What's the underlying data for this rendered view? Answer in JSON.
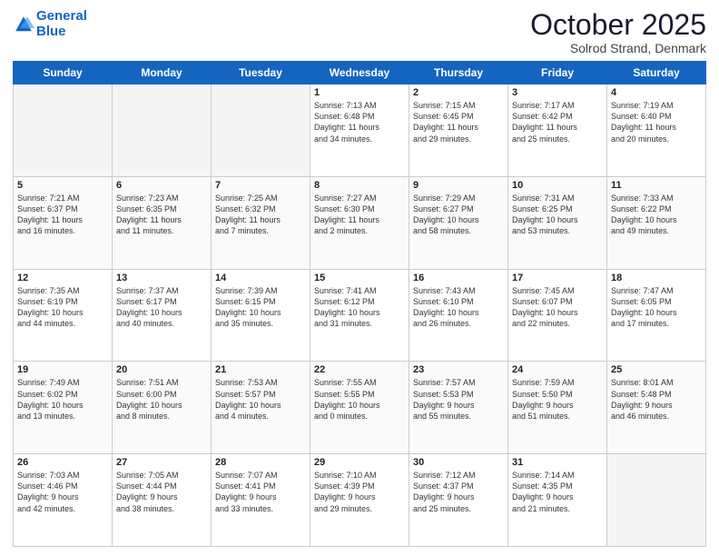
{
  "header": {
    "logo_line1": "General",
    "logo_line2": "Blue",
    "month": "October 2025",
    "location": "Solrod Strand, Denmark"
  },
  "weekdays": [
    "Sunday",
    "Monday",
    "Tuesday",
    "Wednesday",
    "Thursday",
    "Friday",
    "Saturday"
  ],
  "weeks": [
    [
      {
        "day": "",
        "info": ""
      },
      {
        "day": "",
        "info": ""
      },
      {
        "day": "",
        "info": ""
      },
      {
        "day": "1",
        "info": "Sunrise: 7:13 AM\nSunset: 6:48 PM\nDaylight: 11 hours\nand 34 minutes."
      },
      {
        "day": "2",
        "info": "Sunrise: 7:15 AM\nSunset: 6:45 PM\nDaylight: 11 hours\nand 29 minutes."
      },
      {
        "day": "3",
        "info": "Sunrise: 7:17 AM\nSunset: 6:42 PM\nDaylight: 11 hours\nand 25 minutes."
      },
      {
        "day": "4",
        "info": "Sunrise: 7:19 AM\nSunset: 6:40 PM\nDaylight: 11 hours\nand 20 minutes."
      }
    ],
    [
      {
        "day": "5",
        "info": "Sunrise: 7:21 AM\nSunset: 6:37 PM\nDaylight: 11 hours\nand 16 minutes."
      },
      {
        "day": "6",
        "info": "Sunrise: 7:23 AM\nSunset: 6:35 PM\nDaylight: 11 hours\nand 11 minutes."
      },
      {
        "day": "7",
        "info": "Sunrise: 7:25 AM\nSunset: 6:32 PM\nDaylight: 11 hours\nand 7 minutes."
      },
      {
        "day": "8",
        "info": "Sunrise: 7:27 AM\nSunset: 6:30 PM\nDaylight: 11 hours\nand 2 minutes."
      },
      {
        "day": "9",
        "info": "Sunrise: 7:29 AM\nSunset: 6:27 PM\nDaylight: 10 hours\nand 58 minutes."
      },
      {
        "day": "10",
        "info": "Sunrise: 7:31 AM\nSunset: 6:25 PM\nDaylight: 10 hours\nand 53 minutes."
      },
      {
        "day": "11",
        "info": "Sunrise: 7:33 AM\nSunset: 6:22 PM\nDaylight: 10 hours\nand 49 minutes."
      }
    ],
    [
      {
        "day": "12",
        "info": "Sunrise: 7:35 AM\nSunset: 6:19 PM\nDaylight: 10 hours\nand 44 minutes."
      },
      {
        "day": "13",
        "info": "Sunrise: 7:37 AM\nSunset: 6:17 PM\nDaylight: 10 hours\nand 40 minutes."
      },
      {
        "day": "14",
        "info": "Sunrise: 7:39 AM\nSunset: 6:15 PM\nDaylight: 10 hours\nand 35 minutes."
      },
      {
        "day": "15",
        "info": "Sunrise: 7:41 AM\nSunset: 6:12 PM\nDaylight: 10 hours\nand 31 minutes."
      },
      {
        "day": "16",
        "info": "Sunrise: 7:43 AM\nSunset: 6:10 PM\nDaylight: 10 hours\nand 26 minutes."
      },
      {
        "day": "17",
        "info": "Sunrise: 7:45 AM\nSunset: 6:07 PM\nDaylight: 10 hours\nand 22 minutes."
      },
      {
        "day": "18",
        "info": "Sunrise: 7:47 AM\nSunset: 6:05 PM\nDaylight: 10 hours\nand 17 minutes."
      }
    ],
    [
      {
        "day": "19",
        "info": "Sunrise: 7:49 AM\nSunset: 6:02 PM\nDaylight: 10 hours\nand 13 minutes."
      },
      {
        "day": "20",
        "info": "Sunrise: 7:51 AM\nSunset: 6:00 PM\nDaylight: 10 hours\nand 8 minutes."
      },
      {
        "day": "21",
        "info": "Sunrise: 7:53 AM\nSunset: 5:57 PM\nDaylight: 10 hours\nand 4 minutes."
      },
      {
        "day": "22",
        "info": "Sunrise: 7:55 AM\nSunset: 5:55 PM\nDaylight: 10 hours\nand 0 minutes."
      },
      {
        "day": "23",
        "info": "Sunrise: 7:57 AM\nSunset: 5:53 PM\nDaylight: 9 hours\nand 55 minutes."
      },
      {
        "day": "24",
        "info": "Sunrise: 7:59 AM\nSunset: 5:50 PM\nDaylight: 9 hours\nand 51 minutes."
      },
      {
        "day": "25",
        "info": "Sunrise: 8:01 AM\nSunset: 5:48 PM\nDaylight: 9 hours\nand 46 minutes."
      }
    ],
    [
      {
        "day": "26",
        "info": "Sunrise: 7:03 AM\nSunset: 4:46 PM\nDaylight: 9 hours\nand 42 minutes."
      },
      {
        "day": "27",
        "info": "Sunrise: 7:05 AM\nSunset: 4:44 PM\nDaylight: 9 hours\nand 38 minutes."
      },
      {
        "day": "28",
        "info": "Sunrise: 7:07 AM\nSunset: 4:41 PM\nDaylight: 9 hours\nand 33 minutes."
      },
      {
        "day": "29",
        "info": "Sunrise: 7:10 AM\nSunset: 4:39 PM\nDaylight: 9 hours\nand 29 minutes."
      },
      {
        "day": "30",
        "info": "Sunrise: 7:12 AM\nSunset: 4:37 PM\nDaylight: 9 hours\nand 25 minutes."
      },
      {
        "day": "31",
        "info": "Sunrise: 7:14 AM\nSunset: 4:35 PM\nDaylight: 9 hours\nand 21 minutes."
      },
      {
        "day": "",
        "info": ""
      }
    ]
  ]
}
